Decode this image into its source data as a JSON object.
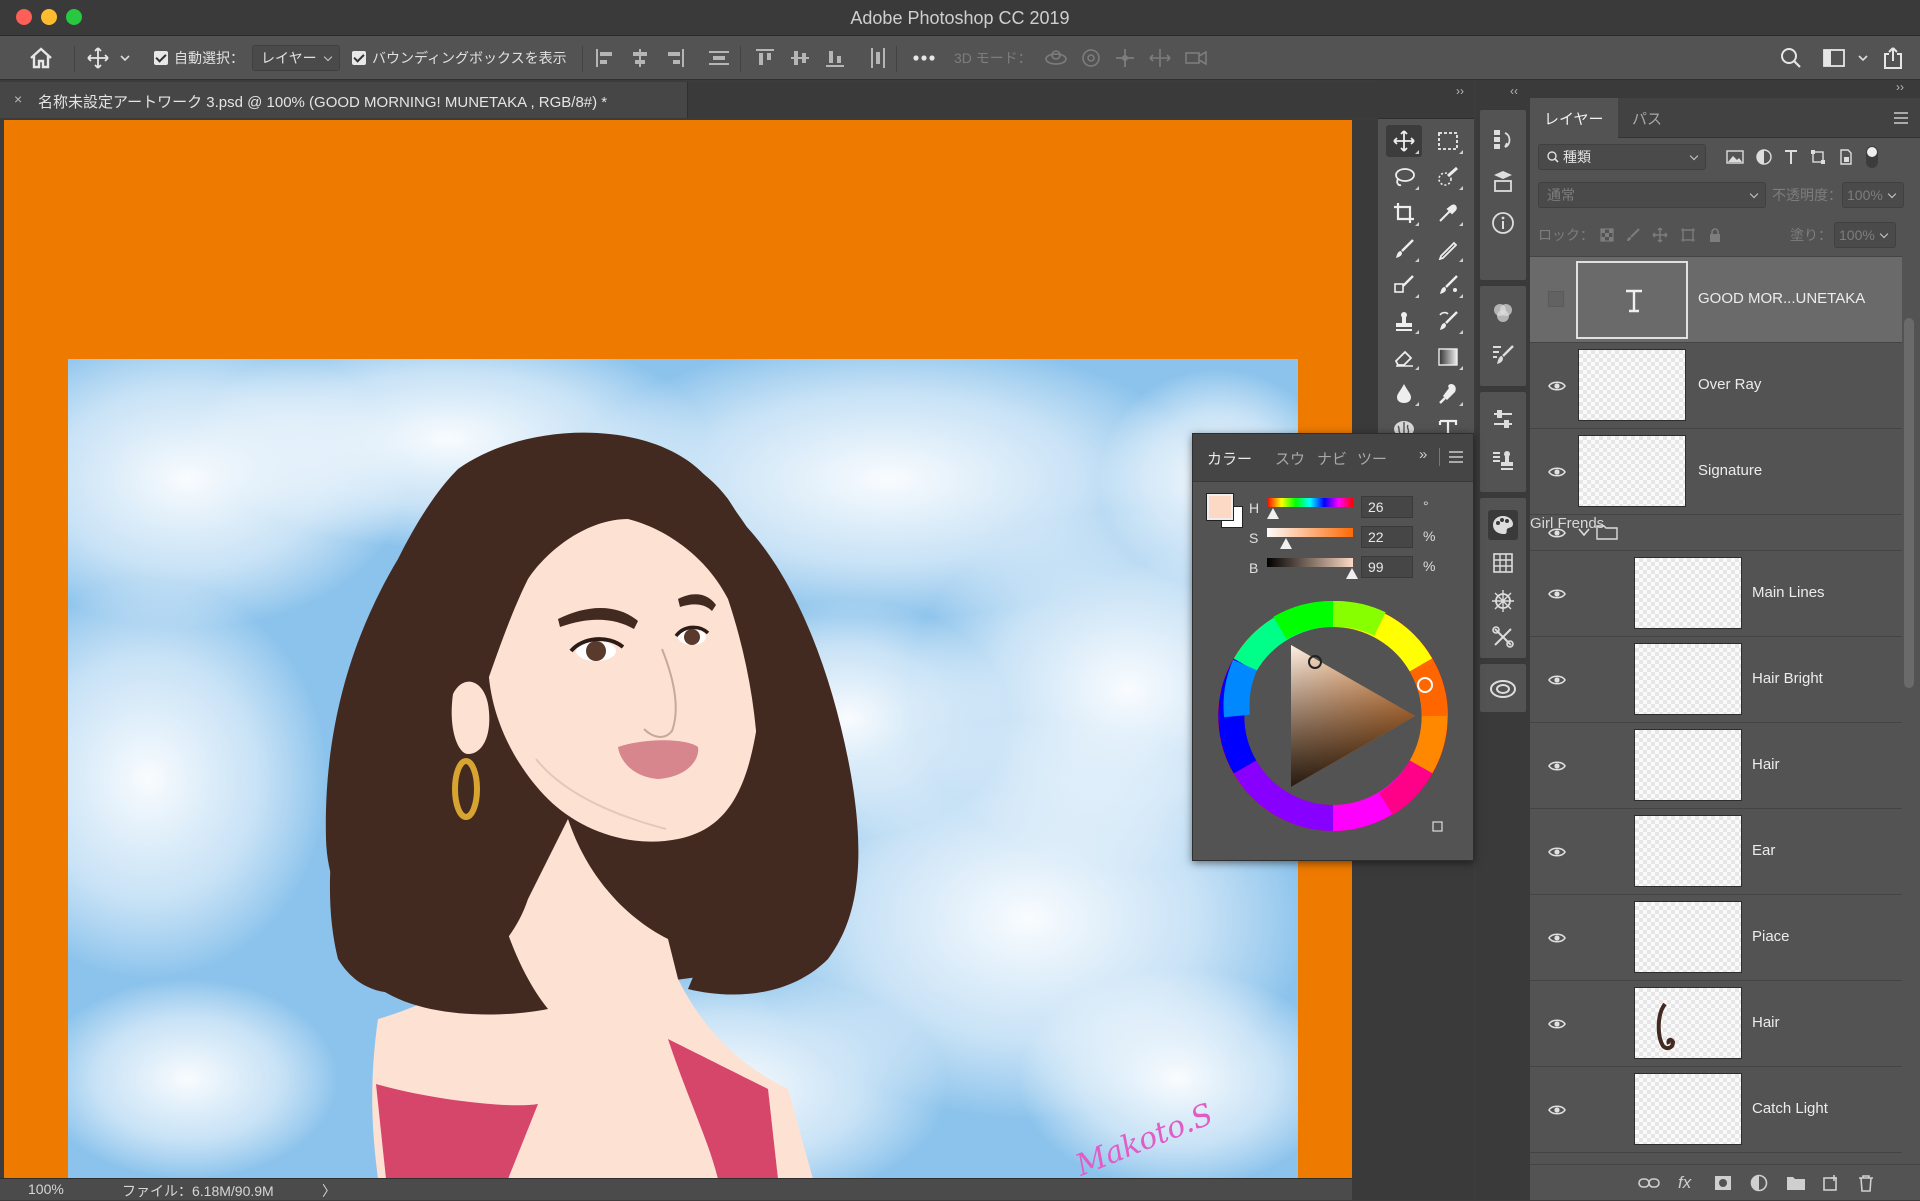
{
  "window": {
    "title": "Adobe Photoshop CC 2019"
  },
  "options_bar": {
    "auto_select_label": "自動選択：",
    "auto_select_target": "レイヤー",
    "show_bbox_label": "バウンディングボックスを表示",
    "mode_3d_label": "3D モード："
  },
  "document": {
    "tab_title": "名称未設定アートワーク 3.psd @ 100% (GOOD MORNING! MUNETAKA , RGB/8#) *",
    "close_glyph": "×"
  },
  "status": {
    "zoom": "100%",
    "file_size": "ファイル：6.18M/90.9M",
    "arrow": "〉"
  },
  "artwork": {
    "signature_text": "Makoto.S"
  },
  "color_panel": {
    "tabs": [
      "カラー",
      "スウ",
      "ナビ",
      "ツー"
    ],
    "active_tab": "カラー",
    "h": {
      "label": "H",
      "value": "26",
      "unit": "°",
      "fraction": 0.07
    },
    "s": {
      "label": "S",
      "value": "22",
      "unit": "%",
      "fraction": 0.22
    },
    "b": {
      "label": "B",
      "value": "99",
      "unit": "%",
      "fraction": 0.99
    },
    "foreground_color": "#FCD9C5",
    "background_color": "#FFFFFF"
  },
  "layers_panel": {
    "tabs": [
      "レイヤー",
      "パス"
    ],
    "active_tab": "レイヤー",
    "filter_kind": "種類",
    "blend_mode": "通常",
    "opacity_label": "不透明度：",
    "opacity_value": "100%",
    "lock_label": "ロック：",
    "fill_label": "塗り：",
    "fill_value": "100%",
    "layers": [
      {
        "name": "GOOD MOR...UNETAKA",
        "type": "text",
        "visible": false,
        "selected": true
      },
      {
        "name": "Over Ray",
        "type": "pixel",
        "visible": true
      },
      {
        "name": "Signature",
        "type": "pixel",
        "visible": true
      },
      {
        "name": "Girl Frends",
        "type": "group",
        "visible": true,
        "expanded": true
      },
      {
        "name": "Main Lines",
        "type": "pixel",
        "visible": true,
        "indent": true
      },
      {
        "name": "Hair Bright",
        "type": "pixel",
        "visible": true,
        "indent": true
      },
      {
        "name": "Hair",
        "type": "pixel",
        "visible": true,
        "indent": true
      },
      {
        "name": "Ear",
        "type": "pixel",
        "visible": true,
        "indent": true
      },
      {
        "name": "Piace",
        "type": "pixel",
        "visible": true,
        "indent": true
      },
      {
        "name": "Hair",
        "type": "pixel",
        "visible": true,
        "indent": true,
        "thumb_content": "hair-stroke"
      },
      {
        "name": "Catch Light",
        "type": "pixel",
        "visible": true,
        "indent": true
      }
    ]
  },
  "colors": {
    "canvas_bg": "#EE7A00",
    "hair": "#432A20",
    "skin": "#FDE2D3",
    "dress": "#D6456A",
    "sky": "#8CC3EC"
  }
}
